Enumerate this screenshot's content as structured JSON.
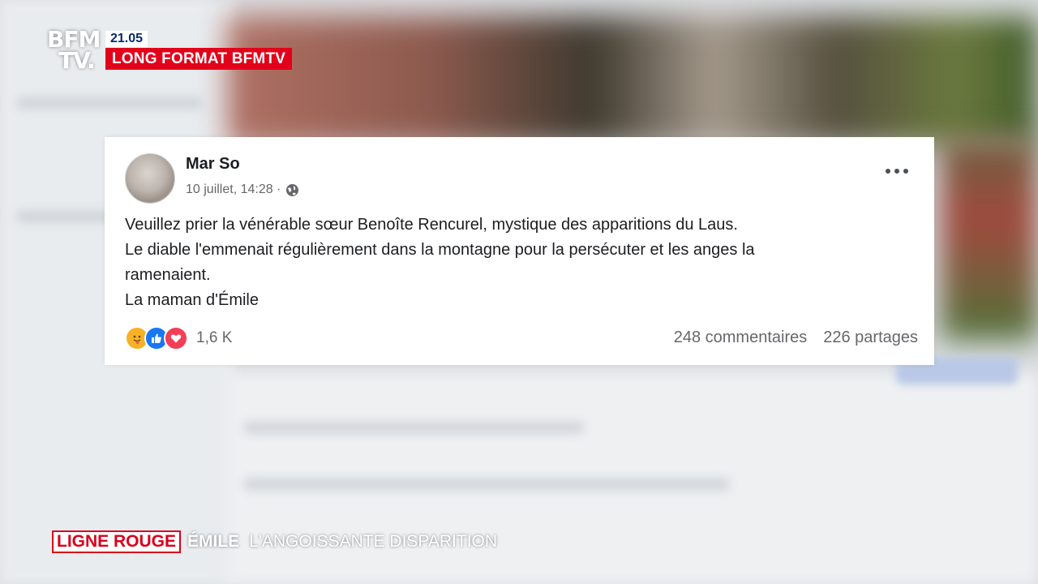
{
  "broadcast": {
    "logo_line1": "BFM",
    "logo_line2": "TV.",
    "time": "21.05",
    "program": "LONG FORMAT BFMTV"
  },
  "post": {
    "author": "Mar So",
    "timestamp": "10 juillet, 14:28 ·",
    "visibility_icon": "globe-icon",
    "more_icon": "more-options-icon",
    "text_lines": [
      "Veuillez prier la vénérable sœur Benoîte Rencurel, mystique des apparitions du Laus.",
      "Le diable l'emmenait régulièrement dans la montagne pour la persécuter et les anges la",
      "ramenaient.",
      "La maman d'Émile"
    ],
    "reactions": {
      "icons": [
        "care-reaction-icon",
        "like-reaction-icon",
        "love-reaction-icon"
      ],
      "count": "1,6 K"
    },
    "comments": "248 commentaires",
    "shares": "226 partages"
  },
  "lower_third": {
    "show": "LIGNE ROUGE",
    "topic": "ÉMILE",
    "subtitle": "L'ANGOISSANTE DISPARITION"
  },
  "colors": {
    "bfm_red": "#e2001a",
    "facebook_blue": "#1877f2",
    "text_gray": "#65676b"
  }
}
